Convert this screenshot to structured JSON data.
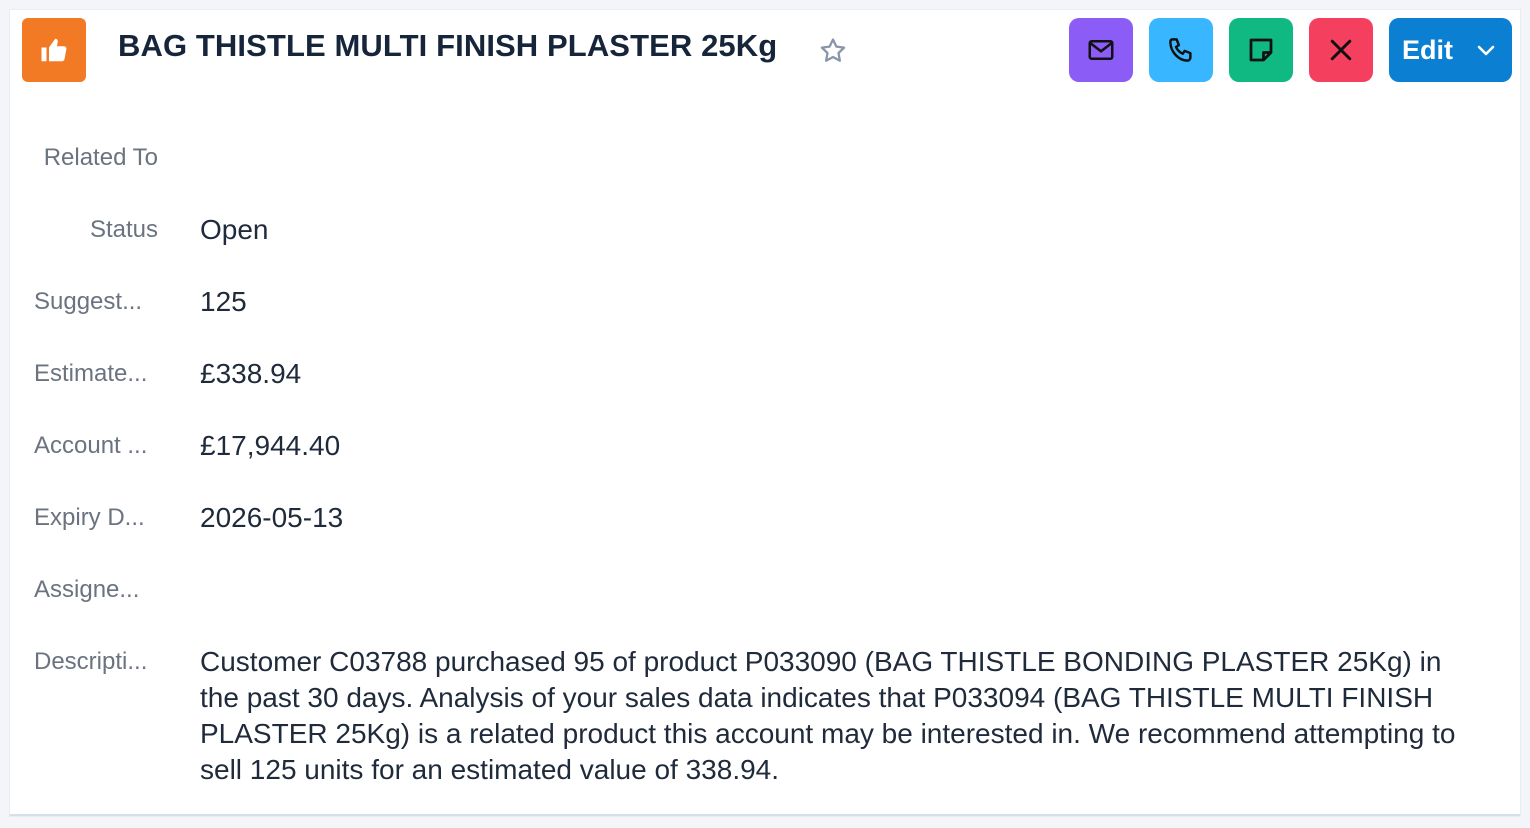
{
  "header": {
    "title": "BAG THISTLE MULTI FINISH PLASTER 25Kg",
    "record_icon": "thumbs-up-icon",
    "record_icon_color": "#f27a25",
    "favorite_icon": "star-icon",
    "actions": {
      "email_icon": "mail-icon",
      "email_color": "#8b5cf6",
      "call_icon": "phone-icon",
      "call_color": "#38b6ff",
      "note_icon": "sticky-note-icon",
      "note_color": "#10b981",
      "close_icon": "x-icon",
      "close_color": "#f43f5e",
      "edit_label": "Edit",
      "edit_color": "#0b7fd1"
    }
  },
  "fields": {
    "related_to": {
      "label": "Related To",
      "value": ""
    },
    "status": {
      "label": "Status",
      "value": "Open"
    },
    "suggested": {
      "label": "Suggest...",
      "value": "125"
    },
    "estimated": {
      "label": "Estimate...",
      "value": "£338.94"
    },
    "account": {
      "label": "Account ...",
      "value": "£17,944.40"
    },
    "expiry": {
      "label": "Expiry D...",
      "value": "2026-05-13"
    },
    "assigned": {
      "label": "Assigne...",
      "value": ""
    },
    "description": {
      "label": "Descripti...",
      "value": "Customer C03788 purchased 95 of product P033090 (BAG THISTLE BONDING PLASTER 25Kg) in the past 30 days. Analysis of your sales data indicates that P033094 (BAG THISTLE MULTI FINISH PLASTER 25Kg) is a related product this account may be interested in. We recommend attempting to sell 125 units for an estimated value of 338.94."
    }
  }
}
